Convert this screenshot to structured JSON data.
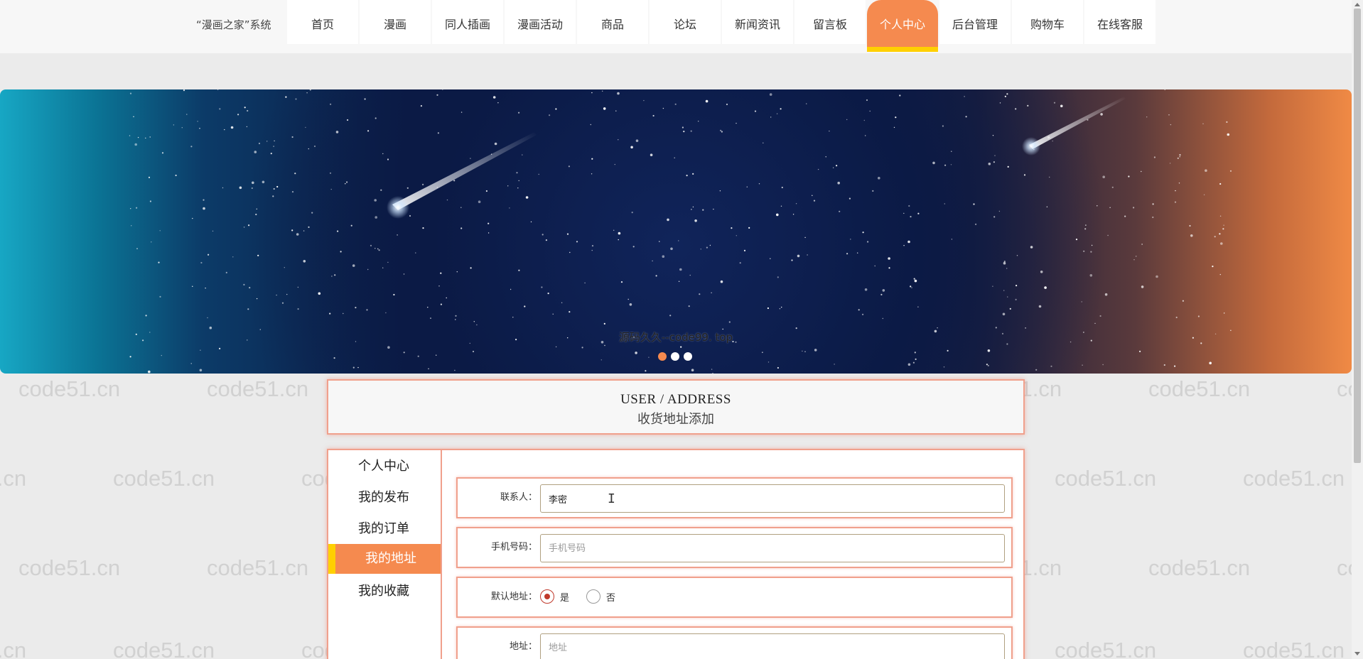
{
  "header": {
    "brand": "“漫画之家”系统",
    "nav": [
      {
        "label": "首页",
        "active": false
      },
      {
        "label": "漫画",
        "active": false
      },
      {
        "label": "同人插画",
        "active": false
      },
      {
        "label": "漫画活动",
        "active": false
      },
      {
        "label": "商品",
        "active": false
      },
      {
        "label": "论坛",
        "active": false
      },
      {
        "label": "新闻资讯",
        "active": false
      },
      {
        "label": "留言板",
        "active": false
      },
      {
        "label": "个人中心",
        "active": true
      },
      {
        "label": "后台管理",
        "active": false
      },
      {
        "label": "购物车",
        "active": false
      },
      {
        "label": "在线客服",
        "active": false
      }
    ]
  },
  "banner": {
    "caption": "源码久久--code99. top",
    "slide_count": 3,
    "active_slide": 1
  },
  "page": {
    "title_en": "USER / ADDRESS",
    "title_cn": "收货地址添加"
  },
  "sidebar": {
    "items": [
      {
        "label": "个人中心",
        "active": false
      },
      {
        "label": "我的发布",
        "active": false
      },
      {
        "label": "我的订单",
        "active": false
      },
      {
        "label": "我的地址",
        "active": true
      },
      {
        "label": "我的收藏",
        "active": false
      }
    ]
  },
  "form": {
    "contact": {
      "label": "联系人：",
      "value": "李密",
      "placeholder": "联系人"
    },
    "phone": {
      "label": "手机号码：",
      "value": "",
      "placeholder": "手机号码"
    },
    "default": {
      "label": "默认地址：",
      "options": [
        "是",
        "否"
      ],
      "selected": "是"
    },
    "address": {
      "label": "地址：",
      "value": "",
      "placeholder": "地址"
    }
  },
  "watermark": "code51.cn",
  "colors": {
    "accent": "#f58a4f",
    "highlight": "#ffd000",
    "border": "#f0a08c",
    "radio_checked": "#c0392b"
  }
}
